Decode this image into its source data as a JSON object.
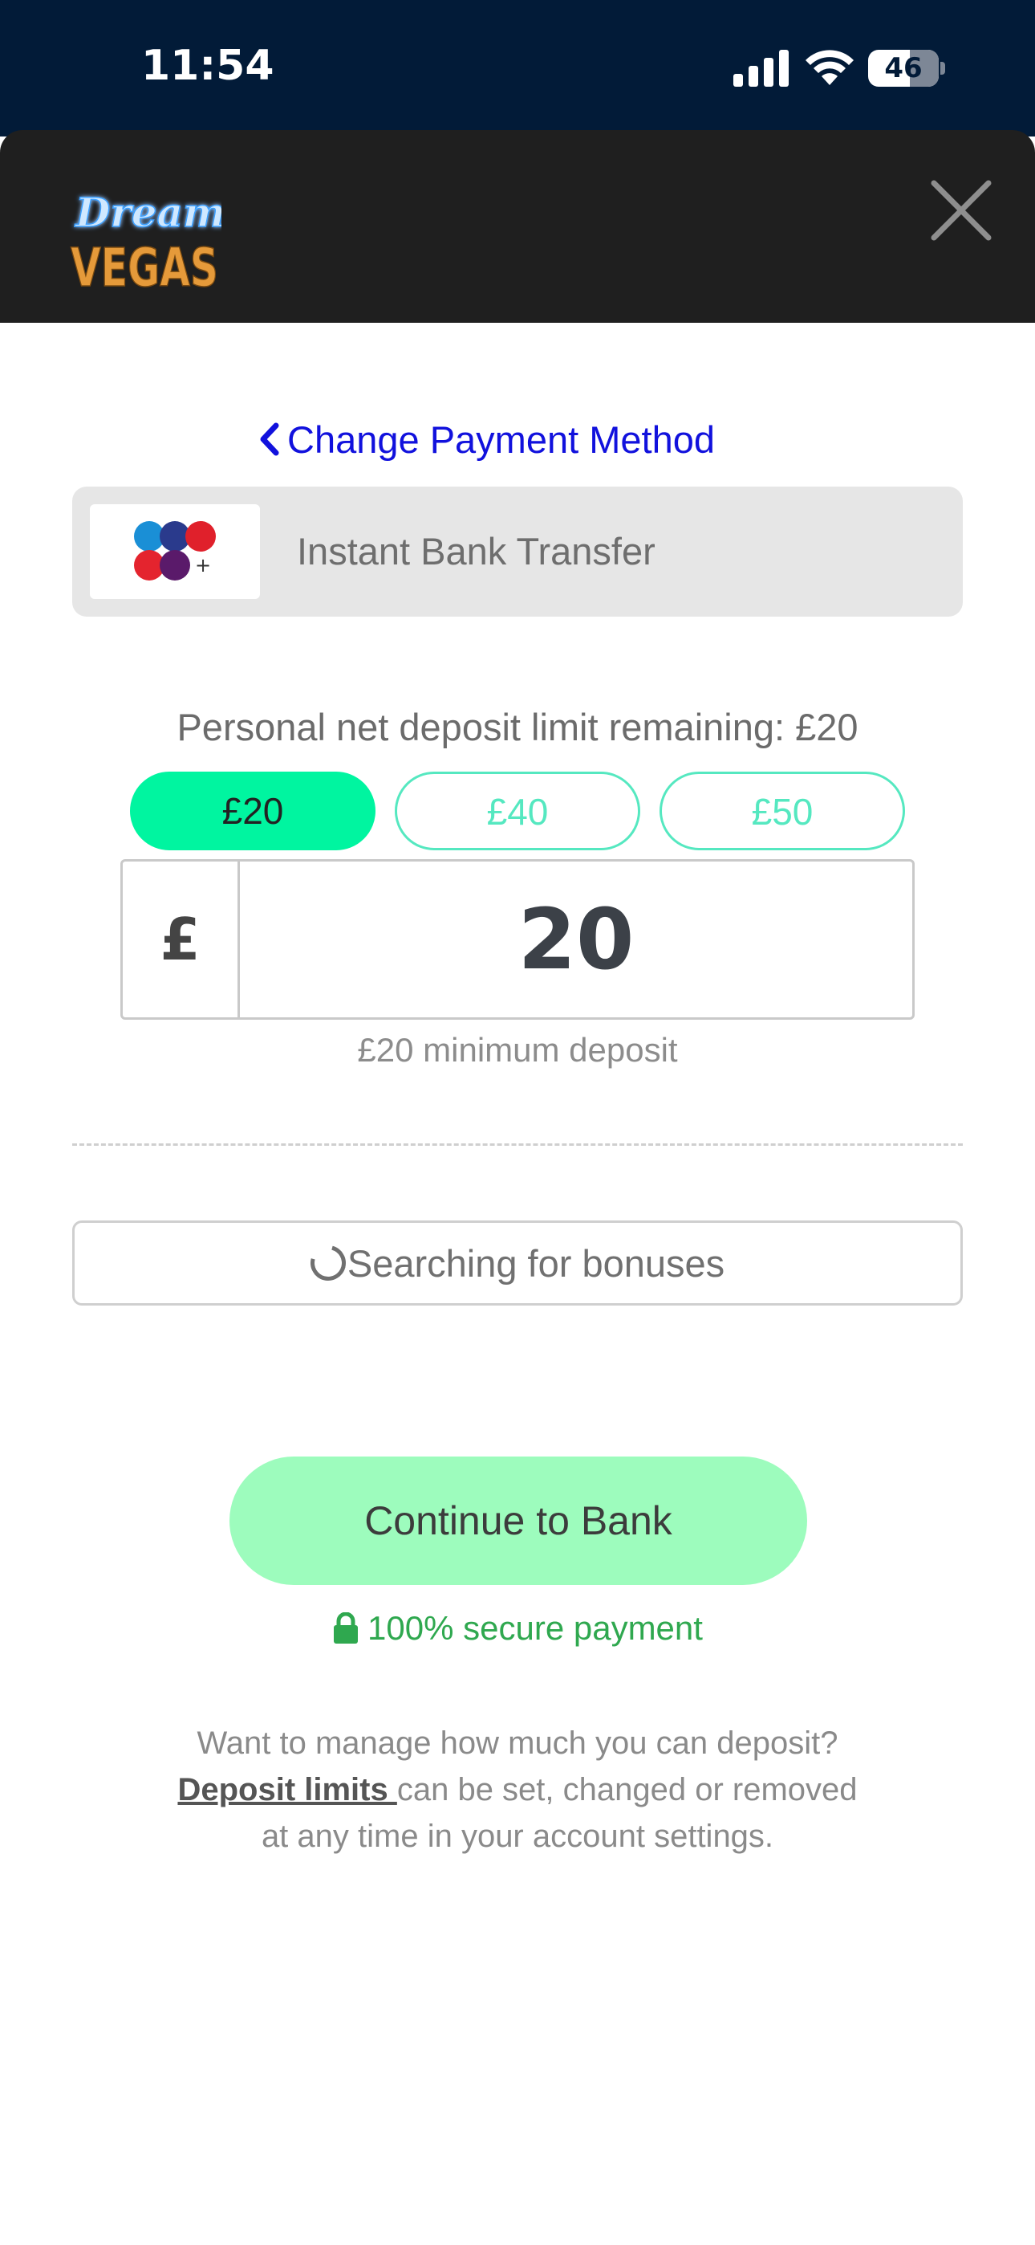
{
  "status_bar": {
    "time": "11:54",
    "battery": "46",
    "icons": [
      "signal-icon",
      "wifi-icon",
      "battery-icon"
    ]
  },
  "header": {
    "logo_text_top": "Dream",
    "logo_text_bottom": "VEGAS",
    "close_icon": "close-icon"
  },
  "payment": {
    "change_link": "Change Payment Method",
    "method_label": "Instant Bank Transfer"
  },
  "deposit": {
    "limit_text": "Personal net deposit limit remaining: £20",
    "preset_amounts": [
      {
        "label": "£20",
        "selected": true
      },
      {
        "label": "£40",
        "selected": false
      },
      {
        "label": "£50",
        "selected": false
      }
    ],
    "currency_symbol": "£",
    "amount": "20",
    "min_note": "£20 minimum deposit"
  },
  "bonus": {
    "label": "Searching for bonuses"
  },
  "actions": {
    "continue_label": "Continue to Bank",
    "secure_label": "100% secure payment"
  },
  "manage": {
    "line1": "Want to manage how much you can deposit?",
    "link_label": "Deposit limits ",
    "line2_rest": "can be set, changed or removed",
    "line3": "at any time in your account settings."
  },
  "colors": {
    "status_bg": "#021b38",
    "header_bg": "#1f1f1f",
    "accent_green": "#00f5a0",
    "chip_outline": "#55e8c0",
    "continue_bg": "#9dfcbd",
    "link_blue": "#1111dd",
    "secure_green": "#2fa84f"
  }
}
